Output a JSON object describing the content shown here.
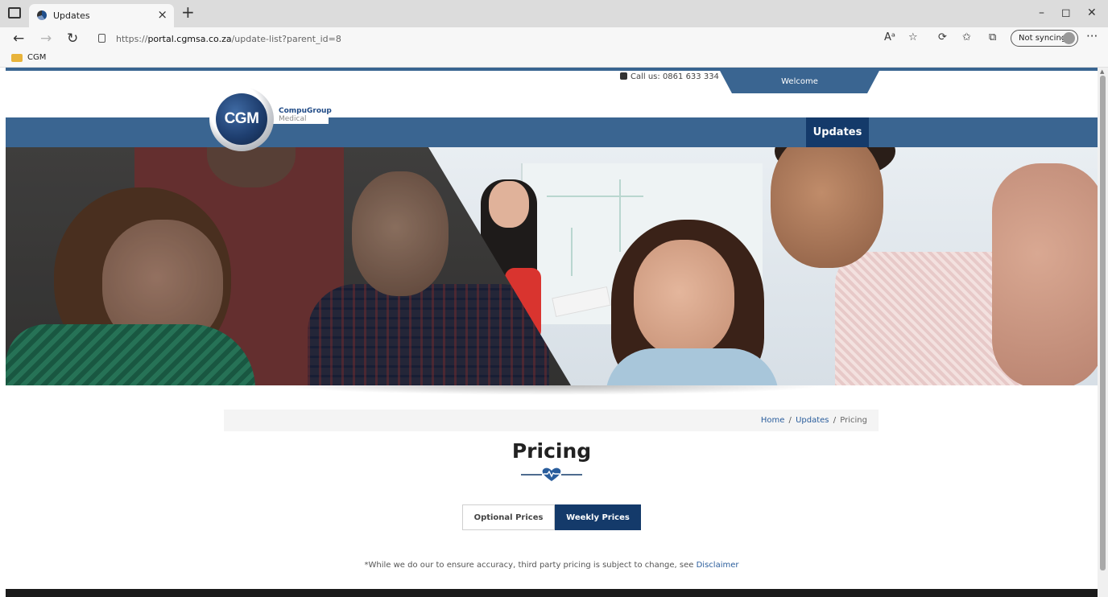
{
  "browser": {
    "tab_title": "Updates",
    "tab_close": "×",
    "new_tab": "+",
    "url_prefix": "https://",
    "url_domain": "portal.cgmsa.co.za",
    "url_path": "/update-list?parent_id=8",
    "sync_label": "Not syncing",
    "favorites": [
      {
        "label": "CGM",
        "icon": "folder-icon"
      }
    ],
    "window_controls": [
      "–",
      "◻",
      "✕"
    ]
  },
  "header": {
    "call_text": "Call us: 0861 633 334",
    "welcome": "Welcome",
    "logo_monogram": "CGM",
    "logo_name": "CompuGroup",
    "logo_sub": "Medical",
    "nav_active": "Updates"
  },
  "breadcrumb": {
    "home": "Home",
    "sep": "/",
    "updates": "Updates",
    "current": "Pricing"
  },
  "page": {
    "title": "Pricing",
    "tabs": [
      {
        "label": "Optional Prices",
        "active": false
      },
      {
        "label": "Weekly Prices",
        "active": true
      }
    ],
    "note": "*While we do our to ensure accuracy, third party pricing is subject to change, see",
    "disclaimer_link": "Disclaimer"
  },
  "colors": {
    "brand": "#3a6591",
    "brand_dark": "#143a6a",
    "link": "#2a5d9c"
  }
}
